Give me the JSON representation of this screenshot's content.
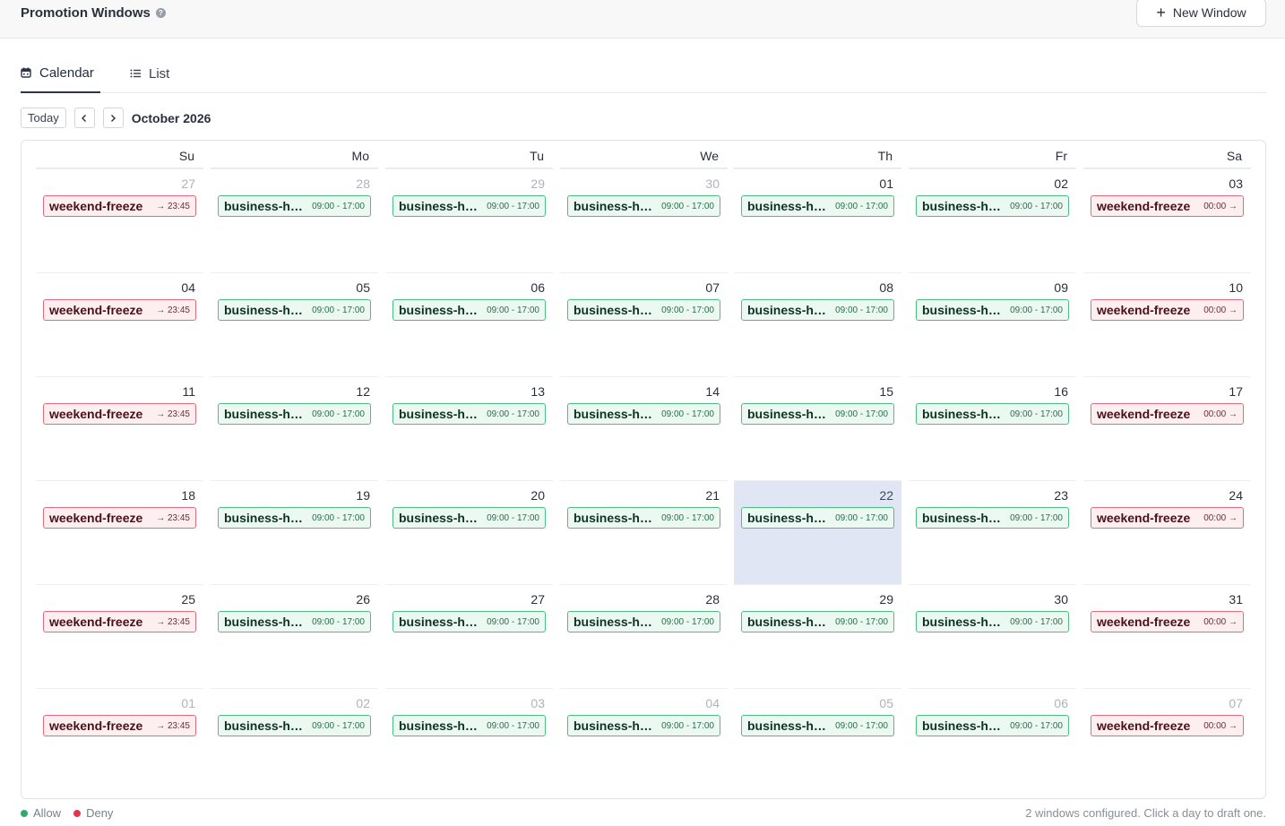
{
  "header": {
    "title": "Promotion Windows",
    "info_icon": "info-icon",
    "new_button_label": "New Window"
  },
  "tabs": [
    {
      "label": "Calendar",
      "icon": "calendar-icon",
      "active": true
    },
    {
      "label": "List",
      "icon": "list-icon",
      "active": false
    }
  ],
  "nav": {
    "today_label": "Today",
    "month_label": "October 2026"
  },
  "calendar": {
    "weekdays": [
      "Su",
      "Mo",
      "Tu",
      "We",
      "Th",
      "Fr",
      "Sa"
    ],
    "today_index": 25,
    "weeks": [
      [
        {
          "day": "27",
          "outside": true,
          "event": "deny-sun"
        },
        {
          "day": "28",
          "outside": true,
          "event": "allow"
        },
        {
          "day": "29",
          "outside": true,
          "event": "allow"
        },
        {
          "day": "30",
          "outside": true,
          "event": "allow"
        },
        {
          "day": "01",
          "outside": false,
          "event": "allow"
        },
        {
          "day": "02",
          "outside": false,
          "event": "allow"
        },
        {
          "day": "03",
          "outside": false,
          "event": "deny-sat"
        }
      ],
      [
        {
          "day": "04",
          "outside": false,
          "event": "deny-sun"
        },
        {
          "day": "05",
          "outside": false,
          "event": "allow"
        },
        {
          "day": "06",
          "outside": false,
          "event": "allow"
        },
        {
          "day": "07",
          "outside": false,
          "event": "allow"
        },
        {
          "day": "08",
          "outside": false,
          "event": "allow"
        },
        {
          "day": "09",
          "outside": false,
          "event": "allow"
        },
        {
          "day": "10",
          "outside": false,
          "event": "deny-sat"
        }
      ],
      [
        {
          "day": "11",
          "outside": false,
          "event": "deny-sun"
        },
        {
          "day": "12",
          "outside": false,
          "event": "allow"
        },
        {
          "day": "13",
          "outside": false,
          "event": "allow"
        },
        {
          "day": "14",
          "outside": false,
          "event": "allow"
        },
        {
          "day": "15",
          "outside": false,
          "event": "allow"
        },
        {
          "day": "16",
          "outside": false,
          "event": "allow"
        },
        {
          "day": "17",
          "outside": false,
          "event": "deny-sat"
        }
      ],
      [
        {
          "day": "18",
          "outside": false,
          "event": "deny-sun"
        },
        {
          "day": "19",
          "outside": false,
          "event": "allow"
        },
        {
          "day": "20",
          "outside": false,
          "event": "allow"
        },
        {
          "day": "21",
          "outside": false,
          "event": "allow"
        },
        {
          "day": "22",
          "outside": false,
          "event": "allow"
        },
        {
          "day": "23",
          "outside": false,
          "event": "allow"
        },
        {
          "day": "24",
          "outside": false,
          "event": "deny-sat"
        }
      ],
      [
        {
          "day": "25",
          "outside": false,
          "event": "deny-sun"
        },
        {
          "day": "26",
          "outside": false,
          "event": "allow"
        },
        {
          "day": "27",
          "outside": false,
          "event": "allow"
        },
        {
          "day": "28",
          "outside": false,
          "event": "allow"
        },
        {
          "day": "29",
          "outside": false,
          "event": "allow"
        },
        {
          "day": "30",
          "outside": false,
          "event": "allow"
        },
        {
          "day": "31",
          "outside": false,
          "event": "deny-sat"
        }
      ],
      [
        {
          "day": "01",
          "outside": true,
          "event": "deny-sun"
        },
        {
          "day": "02",
          "outside": true,
          "event": "allow"
        },
        {
          "day": "03",
          "outside": true,
          "event": "allow"
        },
        {
          "day": "04",
          "outside": true,
          "event": "allow"
        },
        {
          "day": "05",
          "outside": true,
          "event": "allow"
        },
        {
          "day": "06",
          "outside": true,
          "event": "allow"
        },
        {
          "day": "07",
          "outside": true,
          "event": "deny-sat"
        }
      ]
    ],
    "event_types": {
      "allow": {
        "name": "business-hours",
        "time": "09:00 - 17:00",
        "kind": "allow"
      },
      "deny-sun": {
        "name": "weekend-freeze",
        "time": "→ 23:45",
        "kind": "deny"
      },
      "deny-sat": {
        "name": "weekend-freeze",
        "time": "00:00 →",
        "kind": "deny"
      }
    }
  },
  "legend": [
    {
      "label": "Allow",
      "color": "#2faa6b"
    },
    {
      "label": "Deny",
      "color": "#e0364f"
    }
  ],
  "footer": {
    "status": "2 windows configured. Click a day to draft one."
  },
  "colors": {
    "allow_bg": "#ecf8f2",
    "allow_border": "#4fbe85",
    "deny_bg": "#fdeef0",
    "deny_border": "#e46b7f",
    "today_bg": "#e1e6f4"
  }
}
